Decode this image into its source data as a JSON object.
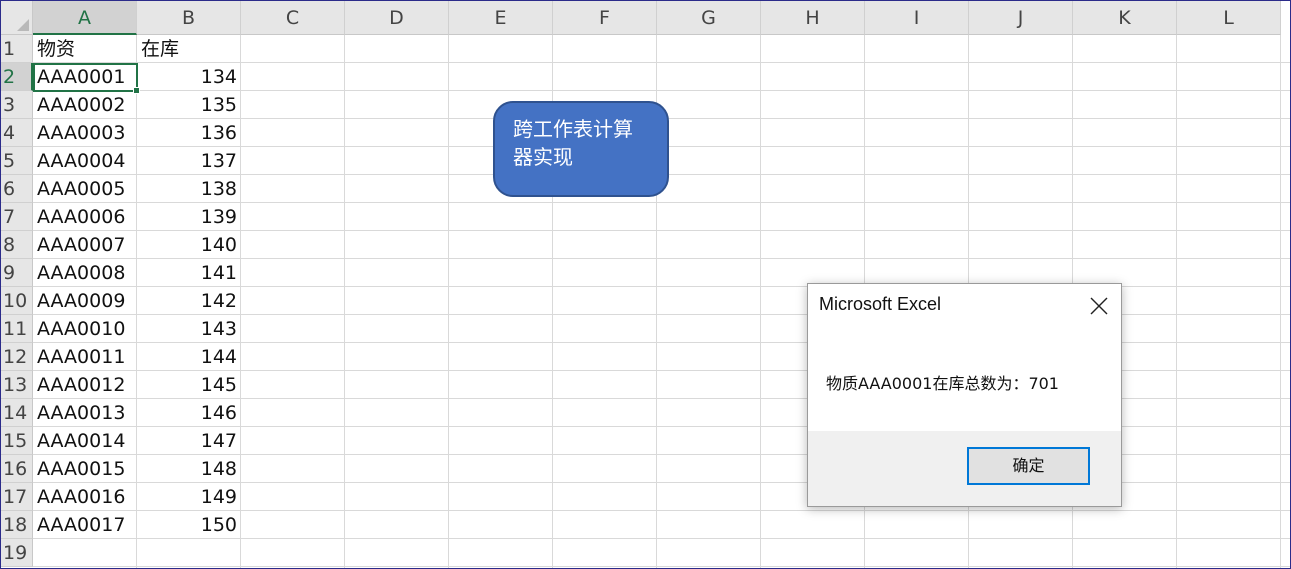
{
  "columns": [
    "A",
    "B",
    "C",
    "D",
    "E",
    "F",
    "G",
    "H",
    "I",
    "J",
    "K",
    "L"
  ],
  "rows": [
    "1",
    "2",
    "3",
    "4",
    "5",
    "6",
    "7",
    "8",
    "9",
    "10",
    "11",
    "12",
    "13",
    "14",
    "15",
    "16",
    "17",
    "18",
    "19"
  ],
  "header_row": {
    "a": "物资",
    "b": "在库"
  },
  "data_rows": [
    {
      "a": "AAA0001",
      "b": "134"
    },
    {
      "a": "AAA0002",
      "b": "135"
    },
    {
      "a": "AAA0003",
      "b": "136"
    },
    {
      "a": "AAA0004",
      "b": "137"
    },
    {
      "a": "AAA0005",
      "b": "138"
    },
    {
      "a": "AAA0006",
      "b": "139"
    },
    {
      "a": "AAA0007",
      "b": "140"
    },
    {
      "a": "AAA0008",
      "b": "141"
    },
    {
      "a": "AAA0009",
      "b": "142"
    },
    {
      "a": "AAA0010",
      "b": "143"
    },
    {
      "a": "AAA0011",
      "b": "144"
    },
    {
      "a": "AAA0012",
      "b": "145"
    },
    {
      "a": "AAA0013",
      "b": "146"
    },
    {
      "a": "AAA0014",
      "b": "147"
    },
    {
      "a": "AAA0015",
      "b": "148"
    },
    {
      "a": "AAA0016",
      "b": "149"
    },
    {
      "a": "AAA0017",
      "b": "150"
    }
  ],
  "selected_cell": {
    "column": "A",
    "row": "2"
  },
  "shape_button": {
    "line1": "跨工作表计算",
    "line2": "器实现"
  },
  "dialog": {
    "title": "Microsoft Excel",
    "message": "物质AAA0001在库总数为：701",
    "ok_label": "确定"
  },
  "colors": {
    "accent_green": "#217346",
    "shape_fill": "#4472c4",
    "dialog_button_border": "#0078d7"
  }
}
